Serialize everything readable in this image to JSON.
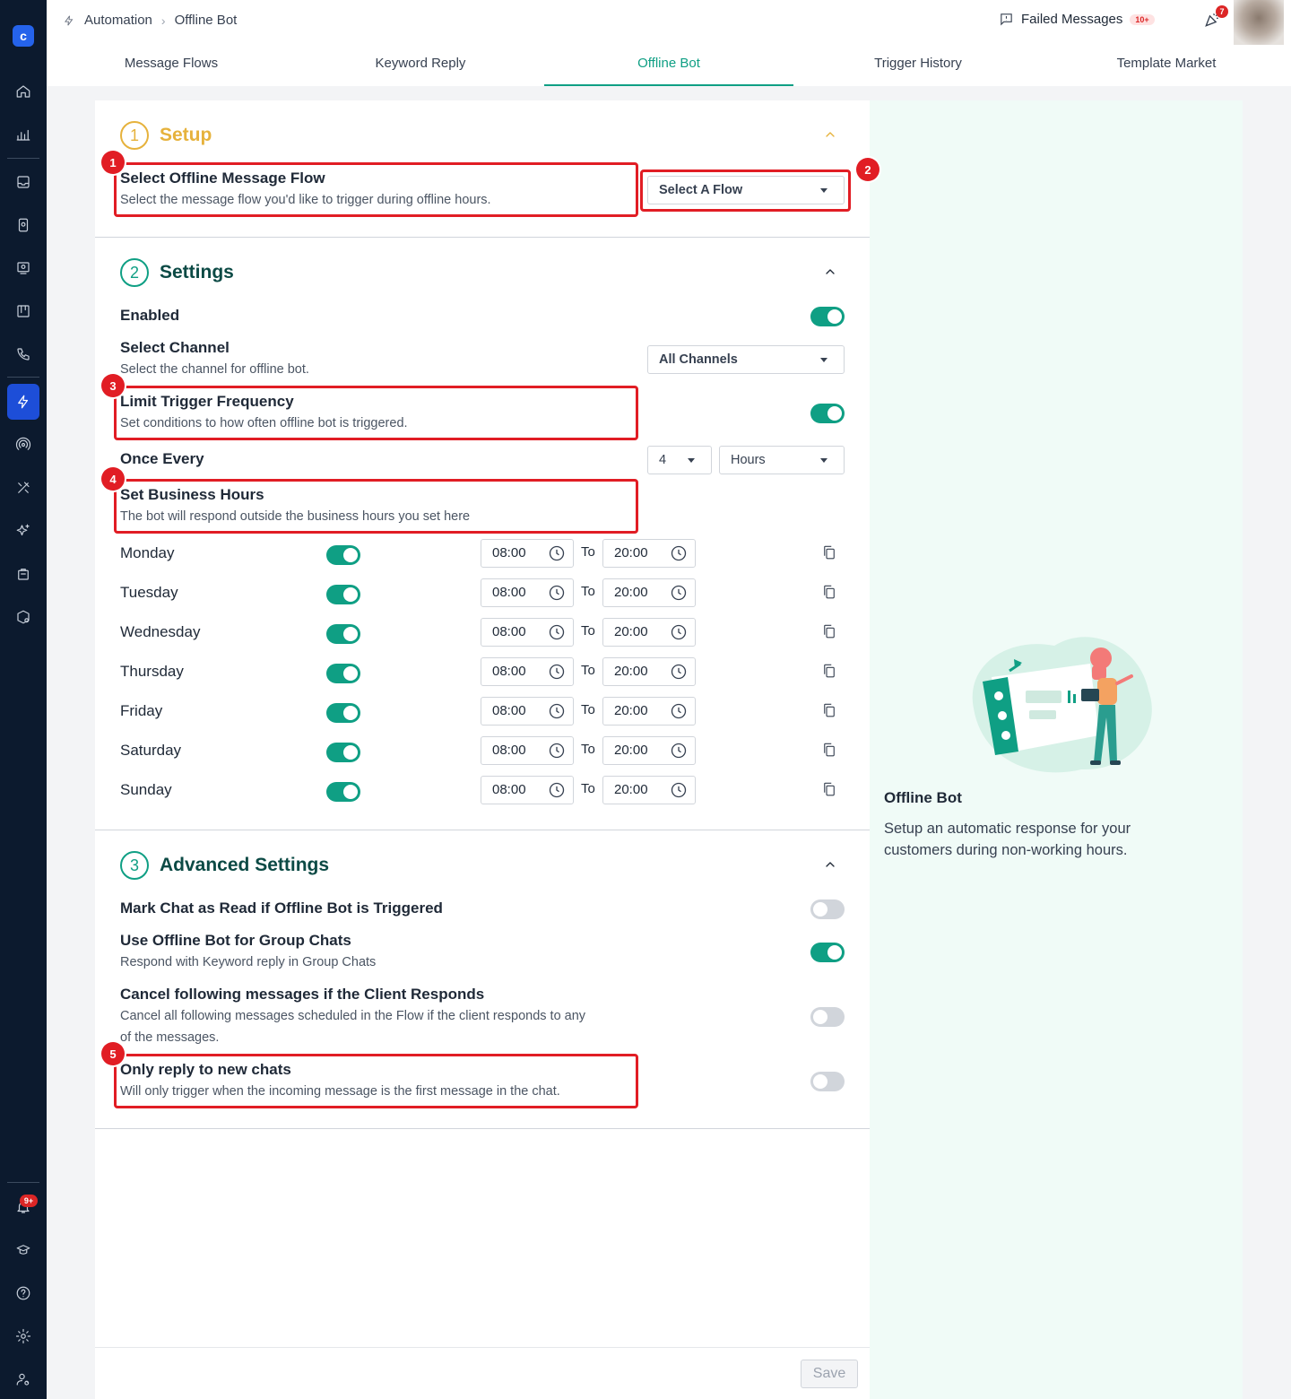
{
  "breadcrumb": {
    "root": "Automation",
    "current": "Offline Bot"
  },
  "topbar": {
    "failed_label": "Failed Messages",
    "failed_count": "10+",
    "notif_count": "7"
  },
  "sidebar": {
    "notif_badge": "9+"
  },
  "tabs": [
    "Message Flows",
    "Keyword Reply",
    "Offline Bot",
    "Trigger History",
    "Template Market"
  ],
  "active_tab": "Offline Bot",
  "setup": {
    "num": "1",
    "title": "Setup",
    "flow_label": "Select Offline Message Flow",
    "flow_desc": "Select the message flow you'd like to trigger during offline hours.",
    "flow_select": "Select A Flow"
  },
  "settings": {
    "num": "2",
    "title": "Settings",
    "enabled_label": "Enabled",
    "enabled": true,
    "channel_label": "Select Channel",
    "channel_desc": "Select the channel for offline bot.",
    "channel_select": "All Channels",
    "limit_label": "Limit Trigger Frequency",
    "limit_desc": "Set conditions to how often offline bot is triggered.",
    "limit_enabled": true,
    "once_label": "Once Every",
    "once_value": "4",
    "once_unit": "Hours",
    "hours_label": "Set Business Hours",
    "hours_desc": "The bot will respond outside the business hours you set here",
    "to_label": "To",
    "days": [
      {
        "name": "Monday",
        "enabled": true,
        "start": "08:00",
        "end": "20:00"
      },
      {
        "name": "Tuesday",
        "enabled": true,
        "start": "08:00",
        "end": "20:00"
      },
      {
        "name": "Wednesday",
        "enabled": true,
        "start": "08:00",
        "end": "20:00"
      },
      {
        "name": "Thursday",
        "enabled": true,
        "start": "08:00",
        "end": "20:00"
      },
      {
        "name": "Friday",
        "enabled": true,
        "start": "08:00",
        "end": "20:00"
      },
      {
        "name": "Saturday",
        "enabled": true,
        "start": "08:00",
        "end": "20:00"
      },
      {
        "name": "Sunday",
        "enabled": true,
        "start": "08:00",
        "end": "20:00"
      }
    ]
  },
  "advanced": {
    "num": "3",
    "title": "Advanced Settings",
    "mark_read_label": "Mark Chat as Read if Offline Bot is Triggered",
    "mark_read": false,
    "group_label": "Use Offline Bot for Group Chats",
    "group_desc": "Respond with Keyword reply in Group Chats",
    "group": true,
    "cancel_label": "Cancel following messages if the Client Responds",
    "cancel_desc_1": "Cancel all following messages scheduled in the Flow if the client responds to any",
    "cancel_desc_2": "of the messages.",
    "cancel": false,
    "new_label": "Only reply to new chats",
    "new_desc": "Will only trigger when the incoming message is the first message in the chat.",
    "new_only": false
  },
  "markers": [
    "1",
    "2",
    "3",
    "4",
    "5"
  ],
  "save_label": "Save",
  "aside": {
    "title": "Offline Bot",
    "desc": "Setup an automatic response for your customers during non-working hours."
  },
  "colors": {
    "accent": "#0f9f84",
    "setup": "#e6b23c",
    "highlight": "#e11d24",
    "sidebar": "#0c1a2e"
  }
}
